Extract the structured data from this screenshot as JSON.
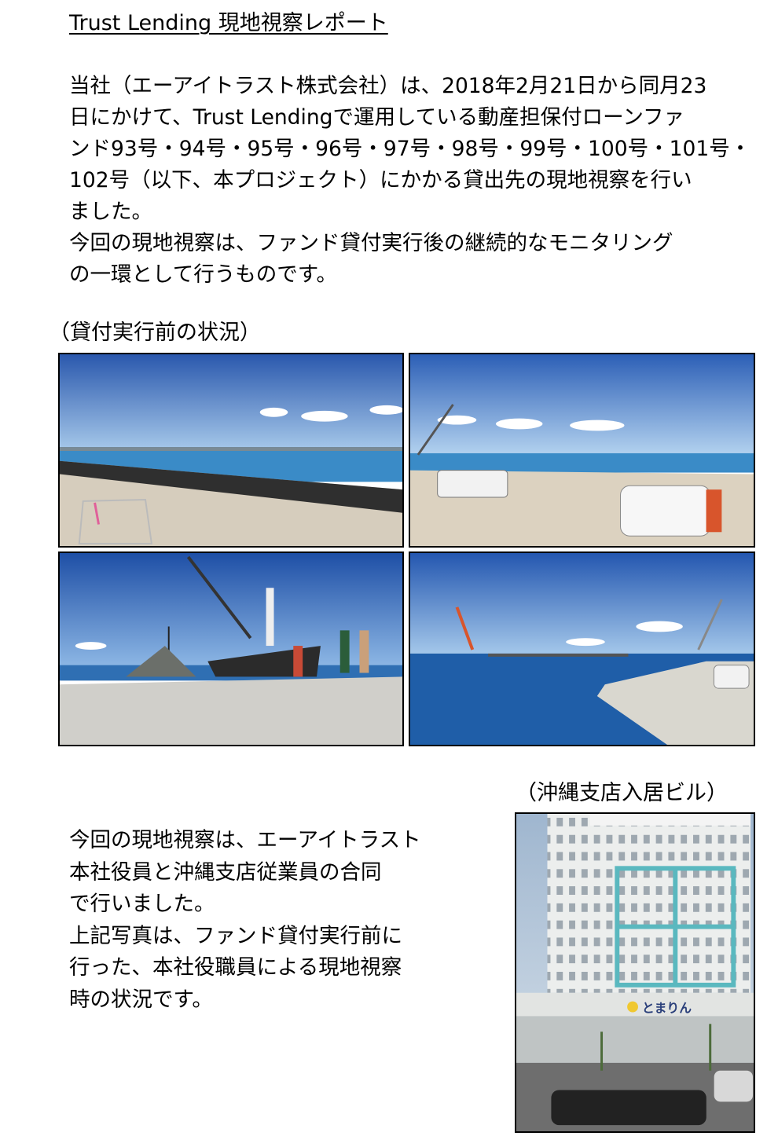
{
  "page": {
    "title": "Trust Lending 現地視察レポート"
  },
  "intro": {
    "lines": [
      "当社（エーアイトラスト株式会社）は、2018年2月21日から同月23",
      "日にかけて、Trust Lendingで運用している動産担保付ローンファ",
      "ンド93号・94号・95号・96号・97号・98号・99号・100号・101号・",
      "102号（以下、本プロジェクト）にかかる貸出先の現地視察を行い",
      "ました。",
      "今回の現地視察は、ファンド貸付実行後の継続的なモニタリング",
      "の一環として行うものです。"
    ]
  },
  "before_section": {
    "label": "（貸付実行前の状況）"
  },
  "building_section": {
    "label": "（沖縄支店入居ビル）",
    "sign_text": "とまりん"
  },
  "caption": {
    "lines": [
      "今回の現地視察は、エーアイトラスト",
      "本社役員と沖縄支店従業員の合同",
      "で行いました。",
      "上記写真は、ファンド貸付実行前に",
      "行った、本社役職員による現地視察",
      "時の状況です。"
    ]
  },
  "colors": {
    "sky_top": "#2c5fb6",
    "sky_bottom": "#9dc4ea",
    "sea": "#2f7fbf",
    "ground": "#d8cfbf",
    "building": "#e9ebea",
    "building_accent": "#5ab8bf"
  }
}
